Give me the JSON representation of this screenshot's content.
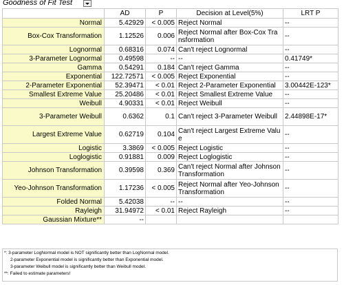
{
  "title": "Goodness of Fit Test",
  "headers": [
    "",
    "AD",
    "P",
    "Decision at Level(5%)",
    "LRT P"
  ],
  "rows": [
    {
      "name": "Normal",
      "ad": "5.42929",
      "p": "< 0.005",
      "decision": "Reject Normal",
      "lrt": "--"
    },
    {
      "name": "Box-Cox Transformation",
      "ad": "1.12526",
      "p": "0.006",
      "decision": "Reject Normal after Box-Cox Transformation",
      "lrt": "--"
    },
    {
      "name": "Lognormal",
      "ad": "0.68316",
      "p": "0.074",
      "decision": "Can't reject Lognormal",
      "lrt": "--"
    },
    {
      "name": "3-Parameter Lognormal",
      "ad": "0.49598",
      "p": "--",
      "decision": "--",
      "lrt": "0.41749*"
    },
    {
      "name": "Gamma",
      "ad": "0.54291",
      "p": "0.184",
      "decision": "Can't reject Gamma",
      "lrt": "--"
    },
    {
      "name": "Exponential",
      "ad": "122.72571",
      "p": "< 0.005",
      "decision": "Reject Exponential",
      "lrt": "--"
    },
    {
      "name": "2-Parameter Exponential",
      "ad": "52.39471",
      "p": "< 0.01",
      "decision": "Reject 2-Parameter Exponential",
      "lrt": "3.00442E-123*"
    },
    {
      "name": "Smallest Extreme Value",
      "ad": "25.20486",
      "p": "< 0.01",
      "decision": "Reject Smallest Extreme Value",
      "lrt": "--"
    },
    {
      "name": "Weibull",
      "ad": "4.90331",
      "p": "< 0.01",
      "decision": "Reject Weibull",
      "lrt": "--"
    },
    {
      "name": "3-Parameter Weibull",
      "ad": "0.6362",
      "p": "0.1",
      "decision": "Can't reject 3-Parameter Weibull",
      "lrt": "2.44898E-17*"
    },
    {
      "name": "Largest Extreme Value",
      "ad": "0.62719",
      "p": "0.104",
      "decision": "Can't reject Largest Extreme Value",
      "lrt": "--"
    },
    {
      "name": "Logistic",
      "ad": "3.3869",
      "p": "< 0.005",
      "decision": "Reject Logistic",
      "lrt": "--"
    },
    {
      "name": "Loglogistic",
      "ad": "0.91881",
      "p": "0.009",
      "decision": "Reject Loglogistic",
      "lrt": "--"
    },
    {
      "name": "Johnson Transformation",
      "ad": "0.39598",
      "p": "0.369",
      "decision": "Can't reject Normal after Johnson Transformation",
      "lrt": "--"
    },
    {
      "name": "Yeo-Johnson Transformation",
      "ad": "1.17236",
      "p": "< 0.005",
      "decision": "Reject Normal after Yeo-Johnson Transformation",
      "lrt": "--"
    },
    {
      "name": "Folded Normal",
      "ad": "5.42038",
      "p": "--",
      "decision": "--",
      "lrt": "--"
    },
    {
      "name": "Rayleigh",
      "ad": "31.94972",
      "p": "< 0.01",
      "decision": "Reject Rayleigh",
      "lrt": "--"
    },
    {
      "name": "Gaussian Mixture**",
      "ad": "--",
      "p": "",
      "decision": "",
      "lrt": ""
    }
  ],
  "notes": [
    "*: 3-parameter LogNormal model is NOT significantly better than LogNormal model.",
    "2-parameter Exponential model is significantly better than Exponential model.",
    "3-parameter Weibull model is significantly better than Weibull model.",
    "**: Failed to estimate parameters!"
  ]
}
